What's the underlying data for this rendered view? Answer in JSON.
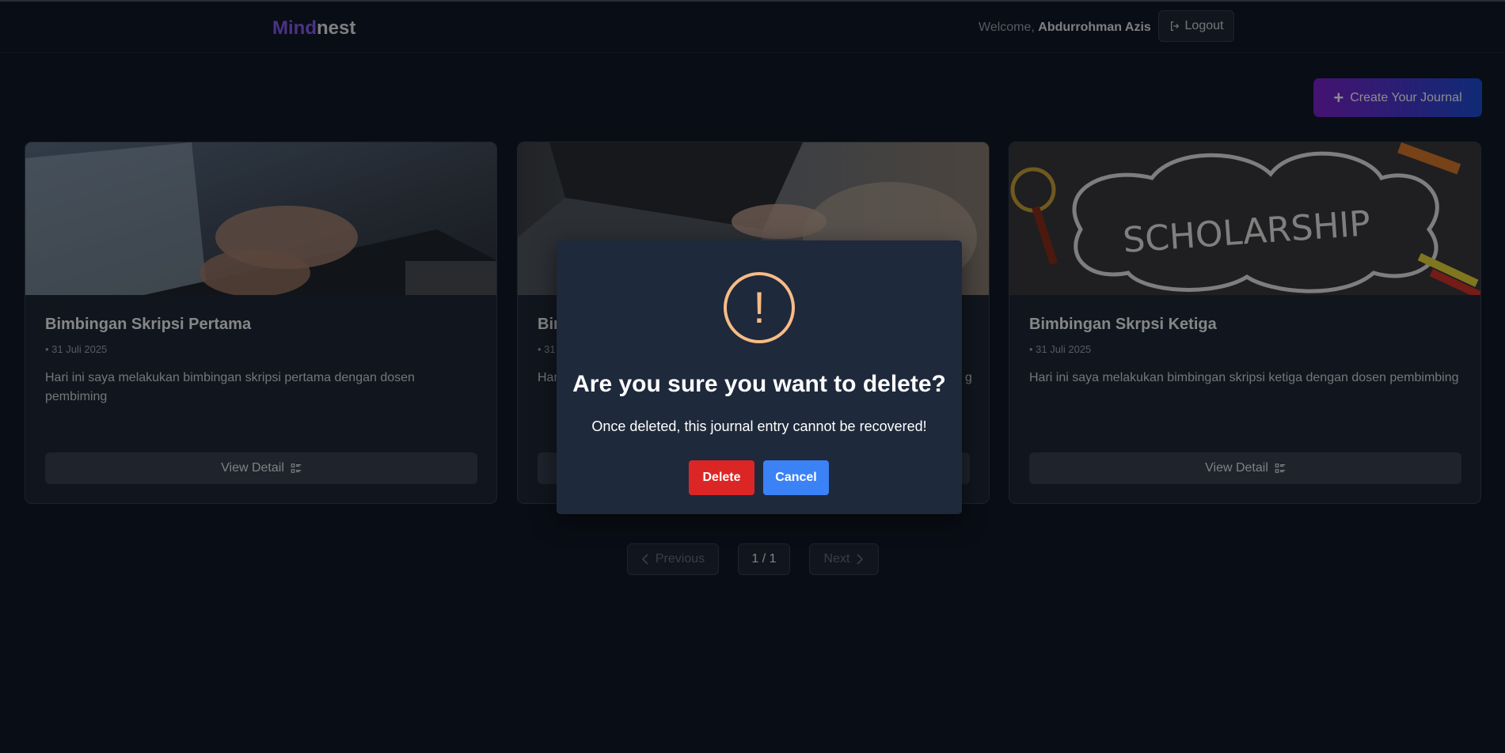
{
  "header": {
    "brand_part1": "Mind",
    "brand_part2": "nest",
    "welcome_prefix": "Welcome,",
    "user_name": "Abdurrohman Azis",
    "logout_label": "Logout"
  },
  "toolbar": {
    "create_label": "Create Your Journal"
  },
  "cards": [
    {
      "title": "Bimbingan Skripsi Pertama",
      "date": "• 31 Juli 2025",
      "description": "Hari ini saya melakukan bimbingan skripsi pertama dengan dosen pembiming",
      "button": "View Detail",
      "image": "laptop-typing-photo"
    },
    {
      "title": "Bir",
      "date": "• 31",
      "description": "Har",
      "description_tail": "g",
      "button": "",
      "image": "laptop-writing-photo"
    },
    {
      "title": "Bimbingan Skrpsi Ketiga",
      "date": "• 31 Juli 2025",
      "description": "Hari ini saya melakukan bimbingan skripsi ketiga dengan dosen pembimbing",
      "button": "View Detail",
      "image": "scholarship-chalkboard-photo",
      "image_text": "SCHOLARSHIP"
    }
  ],
  "pagination": {
    "previous": "Previous",
    "current": "1 / 1",
    "next": "Next"
  },
  "modal": {
    "icon": "!",
    "title": "Are you sure you want to delete?",
    "text": "Once deleted, this journal entry cannot be recovered!",
    "delete_label": "Delete",
    "cancel_label": "Cancel"
  },
  "colors": {
    "background": "#111827",
    "card": "#1f2937",
    "brand_accent": "#8b5cf6",
    "warning": "#f8bb86",
    "delete": "#dc2626",
    "cancel": "#3b82f6"
  }
}
